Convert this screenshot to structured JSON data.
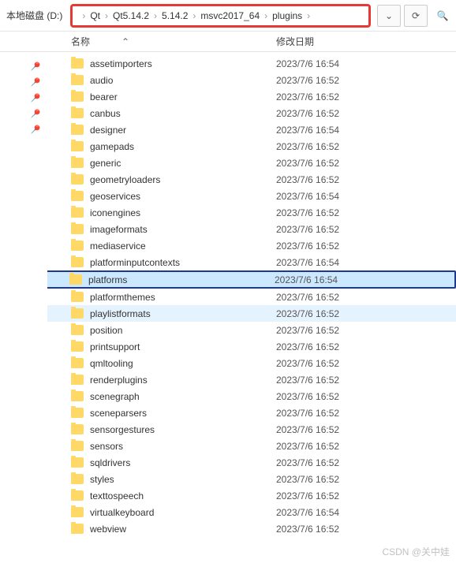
{
  "toolbar": {
    "drive_label": "本地磁盘 (D:)",
    "crumbs": [
      "Qt",
      "Qt5.14.2",
      "5.14.2",
      "msvc2017_64",
      "plugins"
    ],
    "dropdown_icon": "⌄",
    "refresh_icon": "⟳",
    "search_icon": "🔍"
  },
  "columns": {
    "name": "名称",
    "modified": "修改日期",
    "sort_icon": "⌃"
  },
  "files": [
    {
      "name": "assetimporters",
      "date": "2023/7/6 16:54",
      "state": ""
    },
    {
      "name": "audio",
      "date": "2023/7/6 16:52",
      "state": ""
    },
    {
      "name": "bearer",
      "date": "2023/7/6 16:52",
      "state": ""
    },
    {
      "name": "canbus",
      "date": "2023/7/6 16:52",
      "state": ""
    },
    {
      "name": "designer",
      "date": "2023/7/6 16:54",
      "state": ""
    },
    {
      "name": "gamepads",
      "date": "2023/7/6 16:52",
      "state": ""
    },
    {
      "name": "generic",
      "date": "2023/7/6 16:52",
      "state": ""
    },
    {
      "name": "geometryloaders",
      "date": "2023/7/6 16:52",
      "state": ""
    },
    {
      "name": "geoservices",
      "date": "2023/7/6 16:54",
      "state": ""
    },
    {
      "name": "iconengines",
      "date": "2023/7/6 16:52",
      "state": ""
    },
    {
      "name": "imageformats",
      "date": "2023/7/6 16:52",
      "state": ""
    },
    {
      "name": "mediaservice",
      "date": "2023/7/6 16:52",
      "state": ""
    },
    {
      "name": "platforminputcontexts",
      "date": "2023/7/6 16:54",
      "state": ""
    },
    {
      "name": "platforms",
      "date": "2023/7/6 16:54",
      "state": "selected"
    },
    {
      "name": "platformthemes",
      "date": "2023/7/6 16:52",
      "state": ""
    },
    {
      "name": "playlistformats",
      "date": "2023/7/6 16:52",
      "state": "hover"
    },
    {
      "name": "position",
      "date": "2023/7/6 16:52",
      "state": ""
    },
    {
      "name": "printsupport",
      "date": "2023/7/6 16:52",
      "state": ""
    },
    {
      "name": "qmltooling",
      "date": "2023/7/6 16:52",
      "state": ""
    },
    {
      "name": "renderplugins",
      "date": "2023/7/6 16:52",
      "state": ""
    },
    {
      "name": "scenegraph",
      "date": "2023/7/6 16:52",
      "state": ""
    },
    {
      "name": "sceneparsers",
      "date": "2023/7/6 16:52",
      "state": ""
    },
    {
      "name": "sensorgestures",
      "date": "2023/7/6 16:52",
      "state": ""
    },
    {
      "name": "sensors",
      "date": "2023/7/6 16:52",
      "state": ""
    },
    {
      "name": "sqldrivers",
      "date": "2023/7/6 16:52",
      "state": ""
    },
    {
      "name": "styles",
      "date": "2023/7/6 16:52",
      "state": ""
    },
    {
      "name": "texttospeech",
      "date": "2023/7/6 16:52",
      "state": ""
    },
    {
      "name": "virtualkeyboard",
      "date": "2023/7/6 16:54",
      "state": ""
    },
    {
      "name": "webview",
      "date": "2023/7/6 16:52",
      "state": ""
    }
  ],
  "pins": [
    "📌",
    "📌",
    "📌",
    "📌",
    "📌"
  ],
  "watermark": "CSDN @关中娃"
}
